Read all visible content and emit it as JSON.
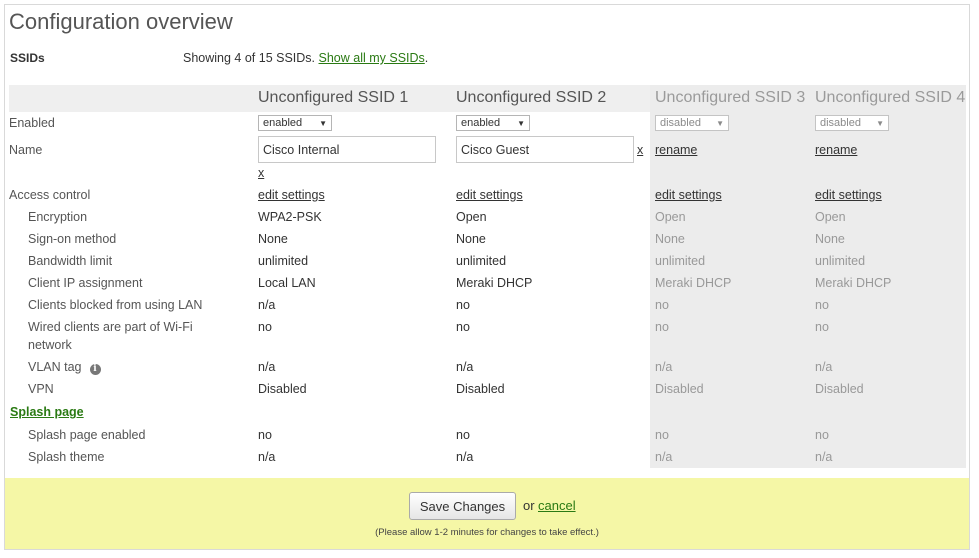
{
  "page": {
    "title": "Configuration overview"
  },
  "ssids": {
    "label": "SSIDs",
    "showing_text": "Showing 4 of 15 SSIDs.",
    "show_all_link": "Show all my SSIDs",
    "period": "."
  },
  "columns": [
    {
      "name": "Unconfigured SSID 1",
      "enabled": "enabled",
      "name_value": "Cisco Internal",
      "remove": "x",
      "access": "edit settings",
      "encryption": "WPA2-PSK",
      "signon": "None",
      "bandwidth": "unlimited",
      "client_ip": "Local LAN",
      "blocked_lan": "n/a",
      "wired_clients": "no",
      "vlan": "n/a",
      "vpn": "Disabled",
      "splash_enabled": "no",
      "splash_theme": "n/a"
    },
    {
      "name": "Unconfigured SSID 2",
      "enabled": "enabled",
      "name_value": "Cisco Guest",
      "remove": "x",
      "access": "edit settings",
      "encryption": "Open",
      "signon": "None",
      "bandwidth": "unlimited",
      "client_ip": "Meraki DHCP",
      "blocked_lan": "no",
      "wired_clients": "no",
      "vlan": "n/a",
      "vpn": "Disabled",
      "splash_enabled": "no",
      "splash_theme": "n/a"
    },
    {
      "name": "Unconfigured SSID 3",
      "enabled": "disabled",
      "rename": "rename",
      "access": "edit settings",
      "encryption": "Open",
      "signon": "None",
      "bandwidth": "unlimited",
      "client_ip": "Meraki DHCP",
      "blocked_lan": "no",
      "wired_clients": "no",
      "vlan": "n/a",
      "vpn": "Disabled",
      "splash_enabled": "no",
      "splash_theme": "n/a"
    },
    {
      "name": "Unconfigured SSID 4",
      "enabled": "disabled",
      "rename": "rename",
      "access": "edit settings",
      "encryption": "Open",
      "signon": "None",
      "bandwidth": "unlimited",
      "client_ip": "Meraki DHCP",
      "blocked_lan": "no",
      "wired_clients": "no",
      "vlan": "n/a",
      "vpn": "Disabled",
      "splash_enabled": "no",
      "splash_theme": "n/a"
    }
  ],
  "rows": {
    "enabled": "Enabled",
    "name": "Name",
    "access_control": "Access control",
    "encryption": "Encryption",
    "signon": "Sign-on method",
    "bandwidth": "Bandwidth limit",
    "client_ip": "Client IP assignment",
    "blocked_lan": "Clients blocked from using LAN",
    "wired_clients_line1": "Wired clients are part of Wi-Fi",
    "wired_clients_line2": "network",
    "vlan": "VLAN tag",
    "vpn": "VPN",
    "splash_page": "Splash page",
    "splash_enabled": "Splash page enabled",
    "splash_theme": "Splash theme"
  },
  "icons": {
    "info": "info-icon",
    "dropdown": "triangle-down"
  },
  "colors": {
    "link": "#2a7a13",
    "footer": "#f5f7a6",
    "disabled_column": "#ececec"
  },
  "footer": {
    "save_label": "Save Changes",
    "or_text": "or",
    "cancel_label": "cancel",
    "note": "(Please allow 1-2 minutes for changes to take effect.)"
  }
}
